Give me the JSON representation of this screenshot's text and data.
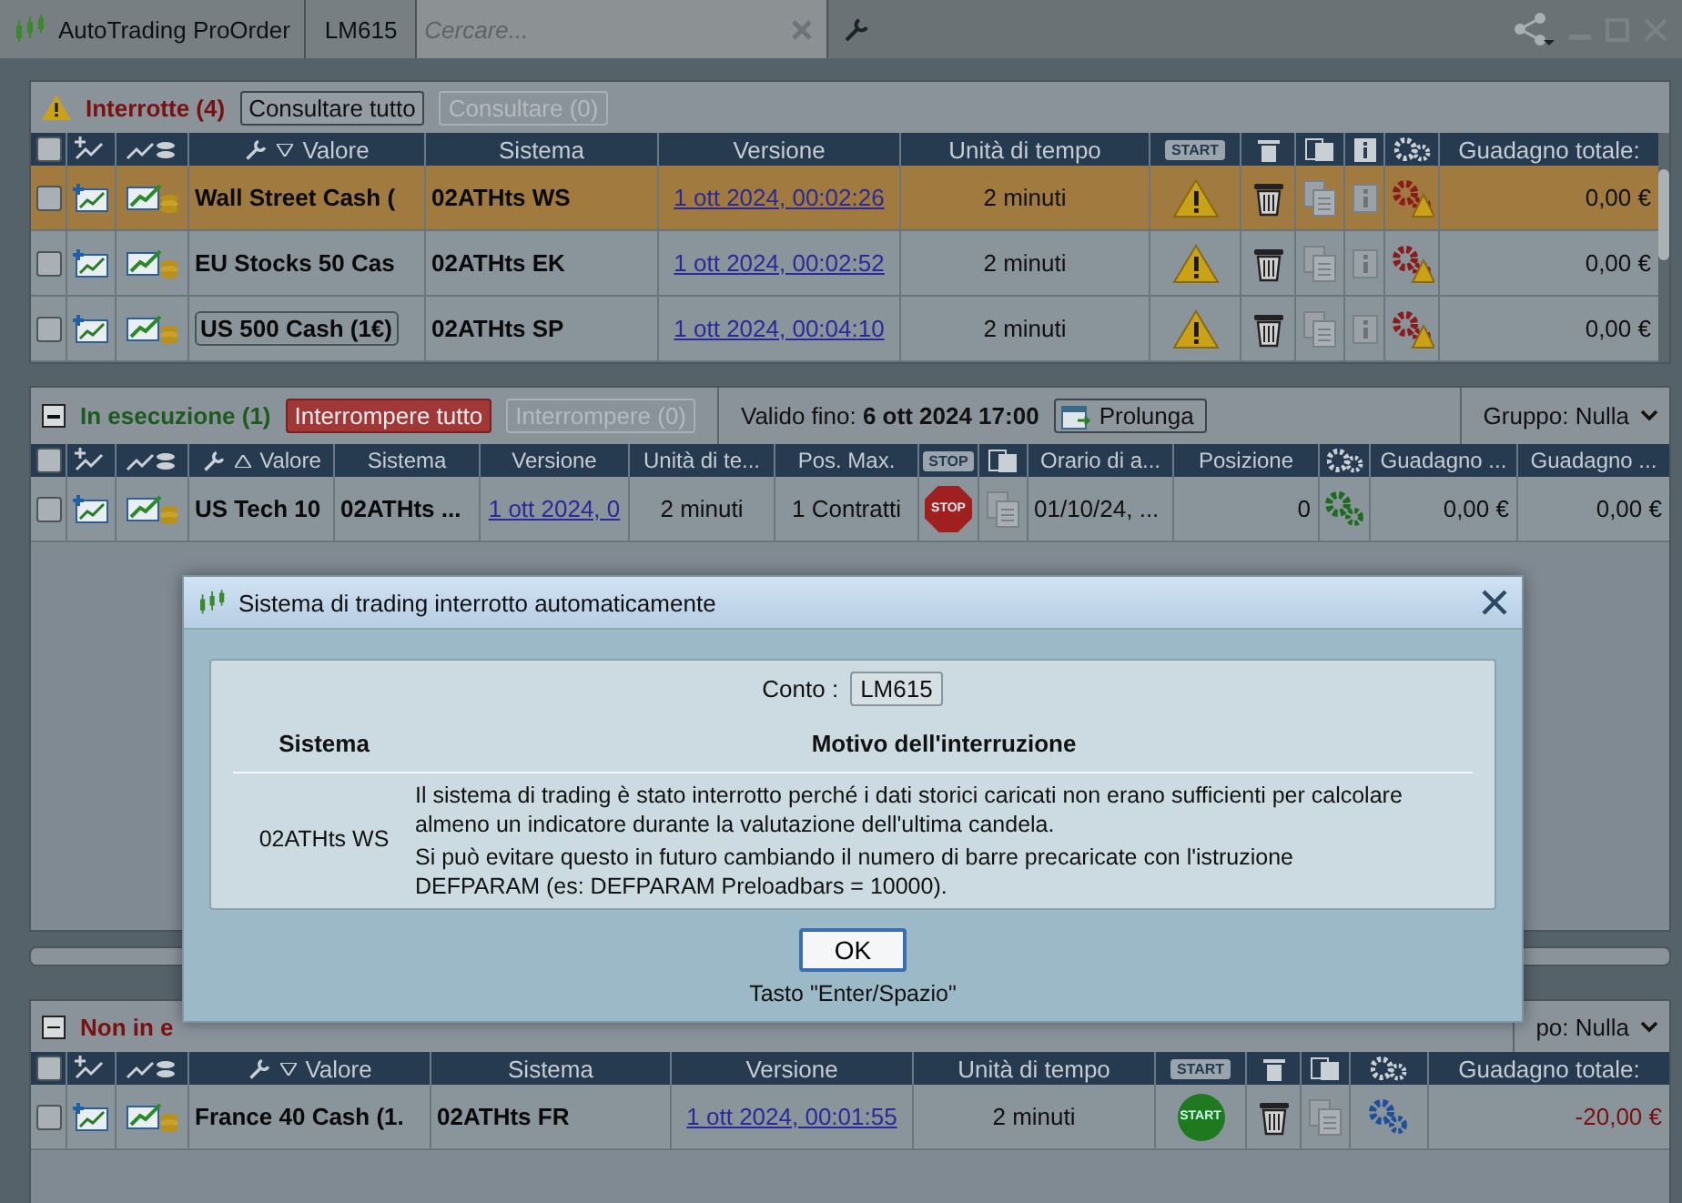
{
  "app_bar": {
    "title": "AutoTrading ProOrder",
    "account": "LM615",
    "search": {
      "placeholder": "Cercare..."
    }
  },
  "sections": [
    {
      "kind": "interrupted",
      "title": "Interrotte (4)",
      "buttons": [
        {
          "label": "Consultare tutto",
          "kind": "normal",
          "disabled": false
        },
        {
          "label": "Consultare (0)",
          "kind": "normal",
          "disabled": true
        }
      ],
      "columns": [
        {
          "kind": "check",
          "checked": false
        },
        {
          "kind": "add"
        },
        {
          "kind": "chart"
        },
        {
          "kind": "valore",
          "label": "Valore",
          "sort_descending": true
        },
        {
          "kind": "text",
          "label": "Sistema"
        },
        {
          "kind": "text",
          "label": "Versione"
        },
        {
          "kind": "text",
          "label": "Unità di tempo"
        },
        {
          "kind": "badge",
          "label": "START"
        },
        {
          "kind": "trash"
        },
        {
          "kind": "copy"
        },
        {
          "kind": "info"
        },
        {
          "kind": "gears"
        },
        {
          "kind": "text",
          "label": "Guadagno totale:"
        }
      ],
      "rows": [
        {
          "selected": true,
          "cells": [
            {
              "kind": "check",
              "checked": false
            },
            {
              "kind": "add"
            },
            {
              "kind": "chart"
            },
            {
              "kind": "bold",
              "text": "Wall Street Cash ("
            },
            {
              "kind": "bold",
              "text": "02ATHts WS"
            },
            {
              "kind": "link",
              "text": "1 ott 2024, 00:02:26"
            },
            {
              "kind": "center",
              "text": "2 minuti"
            },
            {
              "kind": "warn"
            },
            {
              "kind": "trash"
            },
            {
              "kind": "copy"
            },
            {
              "kind": "info"
            },
            {
              "kind": "gears-warn"
            },
            {
              "kind": "num",
              "text": "0,00 €"
            }
          ]
        },
        {
          "selected": false,
          "cells": [
            {
              "kind": "check",
              "checked": false
            },
            {
              "kind": "add"
            },
            {
              "kind": "chart"
            },
            {
              "kind": "bold",
              "text": "EU Stocks 50 Cas"
            },
            {
              "kind": "bold",
              "text": "02ATHts EK"
            },
            {
              "kind": "link",
              "text": "1 ott 2024, 00:02:52"
            },
            {
              "kind": "center",
              "text": "2 minuti"
            },
            {
              "kind": "warn"
            },
            {
              "kind": "trash"
            },
            {
              "kind": "copy"
            },
            {
              "kind": "info"
            },
            {
              "kind": "gears-warn"
            },
            {
              "kind": "num",
              "text": "0,00 €"
            }
          ]
        },
        {
          "selected": false,
          "cells": [
            {
              "kind": "check",
              "checked": false
            },
            {
              "kind": "add"
            },
            {
              "kind": "chart"
            },
            {
              "kind": "bold",
              "text": "US 500 Cash (1€)",
              "focused": true
            },
            {
              "kind": "bold",
              "text": "02ATHts SP"
            },
            {
              "kind": "link",
              "text": "1 ott 2024, 00:04:10"
            },
            {
              "kind": "center",
              "text": "2 minuti"
            },
            {
              "kind": "warn"
            },
            {
              "kind": "trash"
            },
            {
              "kind": "copy"
            },
            {
              "kind": "info"
            },
            {
              "kind": "gears-warn"
            },
            {
              "kind": "num",
              "text": "0,00 €"
            }
          ]
        }
      ]
    },
    {
      "kind": "running",
      "title": "In esecuzione (1)",
      "expanded": true,
      "buttons": [
        {
          "label": "Interrompere tutto",
          "kind": "danger",
          "disabled": false
        },
        {
          "label": "Interrompere (0)",
          "kind": "normal",
          "disabled": true
        }
      ],
      "valid_until": {
        "label": "Valido fino:",
        "value": "6 ott 2024 17:00"
      },
      "extend_button": "Prolunga",
      "group_dropdown": "Gruppo: Nulla",
      "columns": [
        {
          "kind": "check",
          "checked": false
        },
        {
          "kind": "add"
        },
        {
          "kind": "chart"
        },
        {
          "kind": "valore",
          "label": "Valore",
          "sort_descending": false
        },
        {
          "kind": "text",
          "label": "Sistema"
        },
        {
          "kind": "text",
          "label": "Versione"
        },
        {
          "kind": "text",
          "label": "Unità di te..."
        },
        {
          "kind": "text",
          "label": "Pos. Max."
        },
        {
          "kind": "badge",
          "label": "STOP"
        },
        {
          "kind": "copy"
        },
        {
          "kind": "text",
          "label": "Orario di a..."
        },
        {
          "kind": "text",
          "label": "Posizione"
        },
        {
          "kind": "gears"
        },
        {
          "kind": "text",
          "label": "Guadagno ..."
        },
        {
          "kind": "text",
          "label": "Guadagno ..."
        }
      ],
      "rows": [
        {
          "selected": false,
          "cells": [
            {
              "kind": "check",
              "checked": false
            },
            {
              "kind": "add"
            },
            {
              "kind": "chart"
            },
            {
              "kind": "bold",
              "text": "US Tech 10"
            },
            {
              "kind": "bold",
              "text": "02ATHts ..."
            },
            {
              "kind": "link",
              "text": "1 ott 2024, 0"
            },
            {
              "kind": "center",
              "text": "2 minuti"
            },
            {
              "kind": "center",
              "text": "1 Contratti"
            },
            {
              "kind": "stop",
              "text": "STOP"
            },
            {
              "kind": "copy"
            },
            {
              "kind": "text",
              "text": "01/10/24, ..."
            },
            {
              "kind": "num",
              "text": "0"
            },
            {
              "kind": "gears-green"
            },
            {
              "kind": "num",
              "text": "0,00 €"
            },
            {
              "kind": "num",
              "text": "0,00 €"
            }
          ]
        }
      ]
    },
    {
      "kind": "stopped",
      "title": "Non in e",
      "expanded": true,
      "group_dropdown": "po: Nulla",
      "columns": [
        {
          "kind": "check",
          "checked": false
        },
        {
          "kind": "add"
        },
        {
          "kind": "chart"
        },
        {
          "kind": "valore",
          "label": "Valore",
          "sort_descending": true
        },
        {
          "kind": "text",
          "label": "Sistema"
        },
        {
          "kind": "text",
          "label": "Versione"
        },
        {
          "kind": "text",
          "label": "Unità di tempo"
        },
        {
          "kind": "badge",
          "label": "START"
        },
        {
          "kind": "trash"
        },
        {
          "kind": "copy"
        },
        {
          "kind": "gears"
        },
        {
          "kind": "text",
          "label": "Guadagno totale:"
        }
      ],
      "rows": [
        {
          "selected": false,
          "cells": [
            {
              "kind": "check",
              "checked": false
            },
            {
              "kind": "add"
            },
            {
              "kind": "chart"
            },
            {
              "kind": "bold",
              "text": "France 40 Cash (1."
            },
            {
              "kind": "bold",
              "text": "02ATHts FR"
            },
            {
              "kind": "link",
              "text": "1 ott 2024, 00:01:55"
            },
            {
              "kind": "center",
              "text": "2 minuti"
            },
            {
              "kind": "start",
              "text": "START"
            },
            {
              "kind": "trash"
            },
            {
              "kind": "copy"
            },
            {
              "kind": "gears-blue"
            },
            {
              "kind": "neg",
              "text": "-20,00 €"
            }
          ]
        }
      ]
    }
  ],
  "dialog": {
    "title": "Sistema di trading interrotto automaticamente",
    "account_label": "Conto :",
    "account": "LM615",
    "columns": [
      "Sistema",
      "Motivo dell'interruzione"
    ],
    "rows": [
      {
        "system": "02ATHts WS",
        "reason": [
          "Il sistema di trading è stato interrotto perché i dati storici caricati non erano sufficienti per calcolare almeno un indicatore durante la valutazione dell'ultima candela.",
          "Si può evitare questo in futuro cambiando il numero di barre precaricate con l'istruzione DEFPARAM (es: DEFPARAM Preloadbars = 10000)."
        ]
      }
    ],
    "ok_button": "OK",
    "hint": "Tasto \"Enter/Spazio\""
  }
}
